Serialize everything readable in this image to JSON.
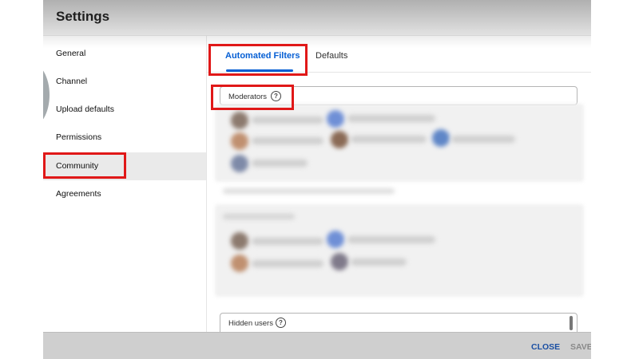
{
  "dialog": {
    "title": "Settings"
  },
  "sidebar": {
    "items": [
      {
        "label": "General"
      },
      {
        "label": "Channel"
      },
      {
        "label": "Upload defaults"
      },
      {
        "label": "Permissions"
      },
      {
        "label": "Community",
        "selected": true
      },
      {
        "label": "Agreements"
      }
    ]
  },
  "tabs": [
    {
      "label": "Automated Filters",
      "active": true
    },
    {
      "label": "Defaults",
      "active": false
    }
  ],
  "moderators": {
    "label": "Moderators",
    "help_icon": "question-circle-icon"
  },
  "hidden_users": {
    "label": "Hidden users",
    "help_icon": "question-circle-icon"
  },
  "footer": {
    "close_label": "CLOSE",
    "save_label": "SAVE"
  },
  "colors": {
    "accent": "#065fd4",
    "highlight": "#e01818",
    "selected_bg": "#eaeaea"
  }
}
